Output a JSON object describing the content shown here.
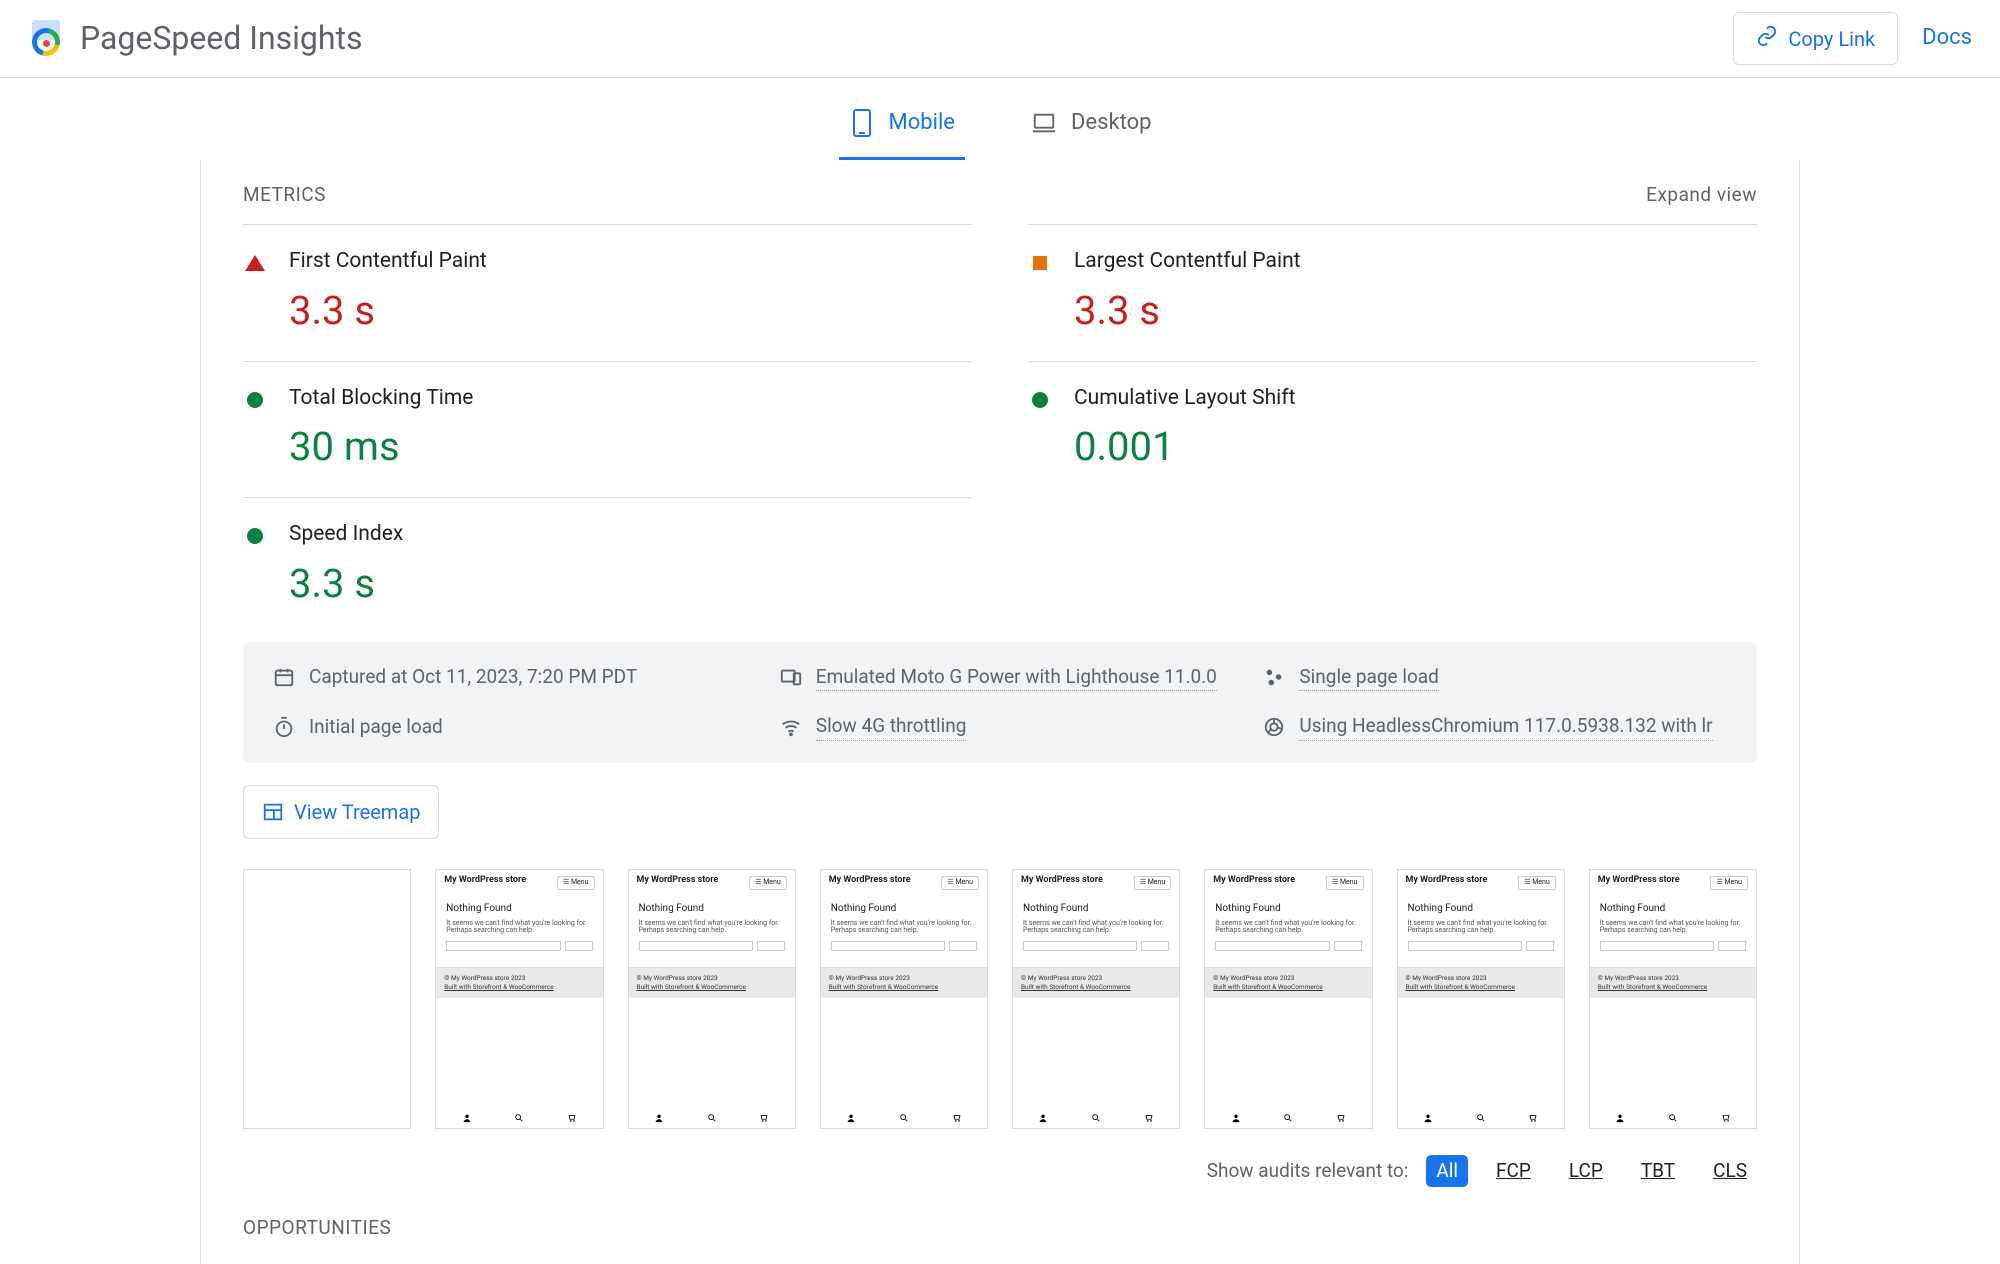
{
  "header": {
    "title": "PageSpeed Insights",
    "copy_label": "Copy Link",
    "docs_label": "Docs"
  },
  "tabs": {
    "mobile": "Mobile",
    "desktop": "Desktop"
  },
  "metrics_header": "METRICS",
  "expand_label": "Expand view",
  "metrics": {
    "fcp": {
      "label": "First Contentful Paint",
      "value": "3.3 s",
      "status": "fail"
    },
    "lcp": {
      "label": "Largest Contentful Paint",
      "value": "3.3 s",
      "status": "avg"
    },
    "tbt": {
      "label": "Total Blocking Time",
      "value": "30 ms",
      "status": "pass"
    },
    "cls": {
      "label": "Cumulative Layout Shift",
      "value": "0.001",
      "status": "pass"
    },
    "si": {
      "label": "Speed Index",
      "value": "3.3 s",
      "status": "pass"
    }
  },
  "env": {
    "captured": "Captured at Oct 11, 2023, 7:20 PM PDT",
    "device": "Emulated Moto G Power with Lighthouse 11.0.0",
    "load": "Single page load",
    "nav": "Initial page load",
    "throttle": "Slow 4G throttling",
    "browser": "Using HeadlessChromium 117.0.5938.132 with lr"
  },
  "treemap_label": "View Treemap",
  "filmstrip": {
    "title": "My WordPress store",
    "menu": "☰  Menu",
    "heading": "Nothing Found",
    "para": "It seems we can't find what you're looking for. Perhaps searching can help.",
    "search_btn": "Search",
    "foot1": "© My WordPress store 2023",
    "foot2": "Built with Storefront & WooCommerce"
  },
  "filters": {
    "label": "Show audits relevant to:",
    "all": "All",
    "fcp": "FCP",
    "lcp": "LCP",
    "tbt": "TBT",
    "cls": "CLS"
  },
  "opportunities_header": "OPPORTUNITIES"
}
